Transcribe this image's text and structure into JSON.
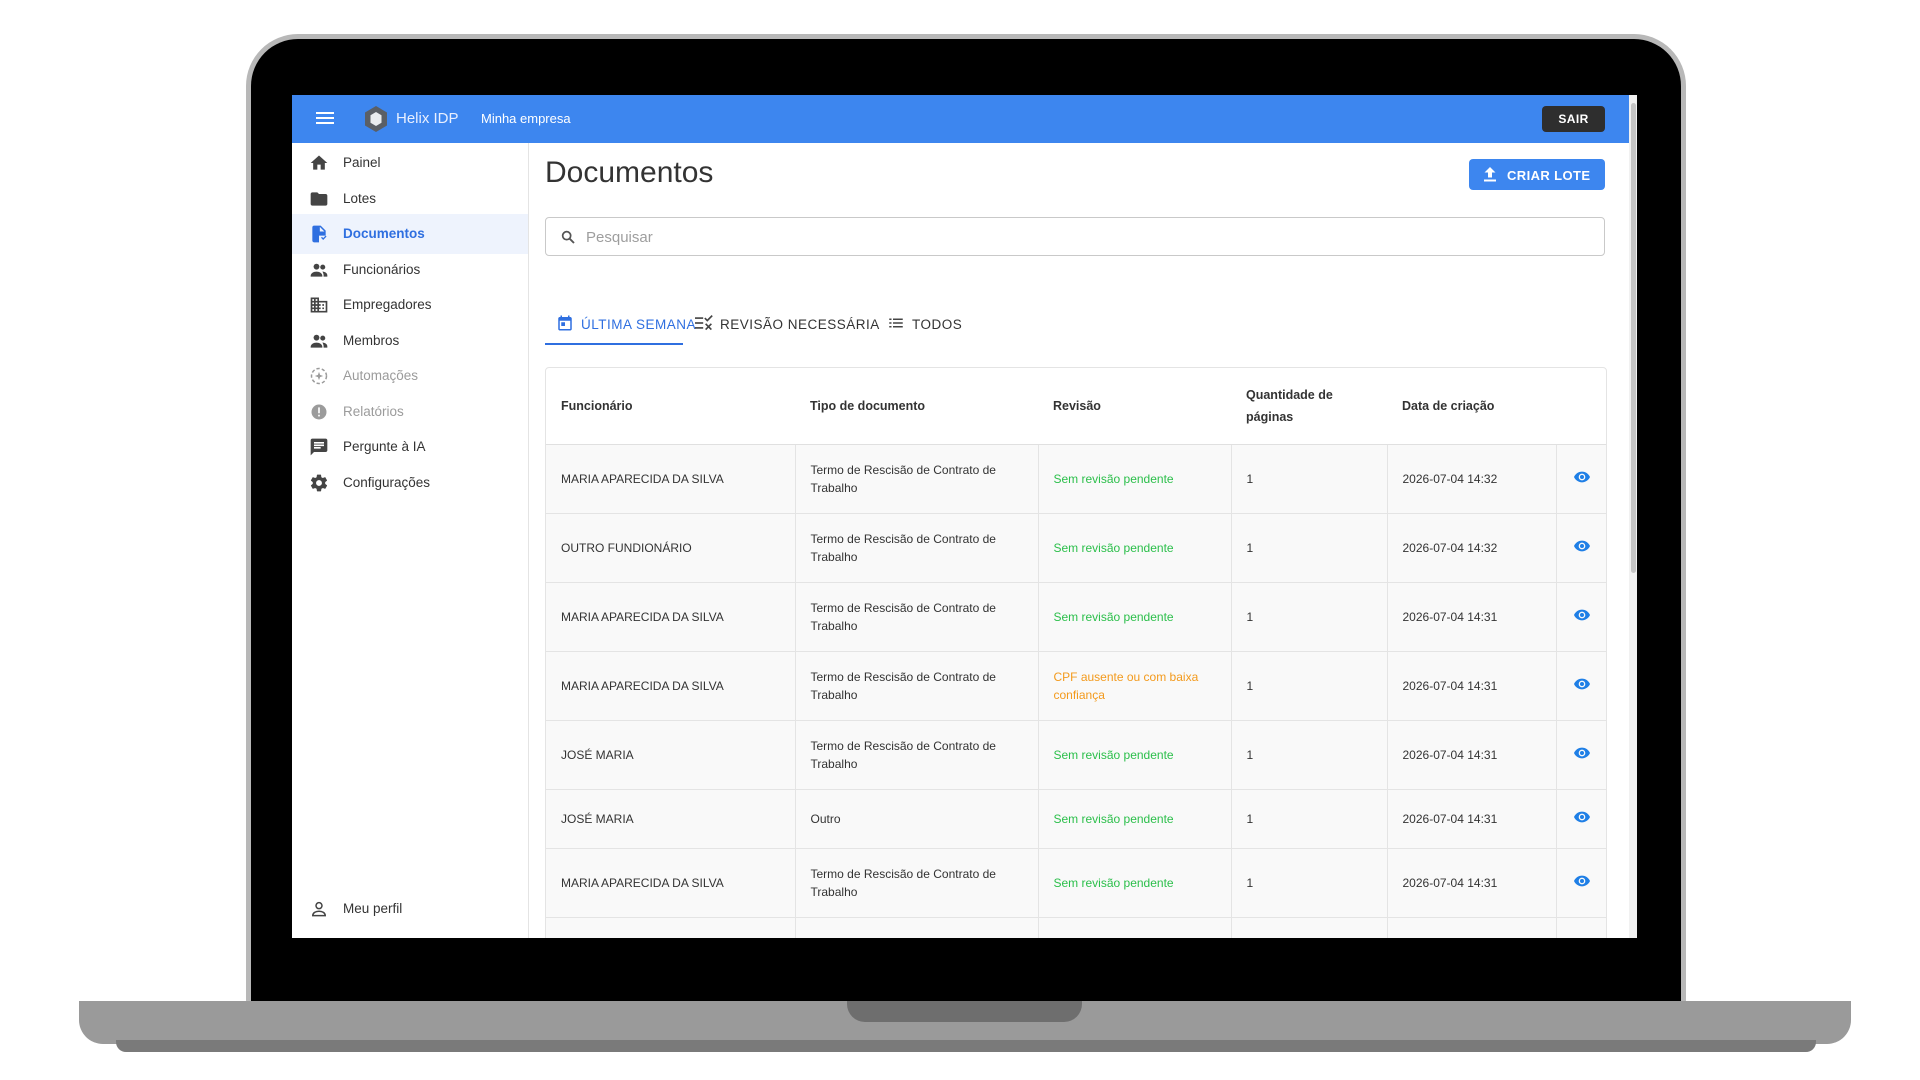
{
  "topbar": {
    "brand": "Helix IDP",
    "company": "Minha empresa",
    "logout_label": "SAIR"
  },
  "sidebar": {
    "items": [
      {
        "label": "Painel",
        "icon": "home-icon"
      },
      {
        "label": "Lotes",
        "icon": "folder-icon"
      },
      {
        "label": "Documentos",
        "icon": "document-icon",
        "active": true
      },
      {
        "label": "Funcionários",
        "icon": "people-icon"
      },
      {
        "label": "Empregadores",
        "icon": "building-icon"
      },
      {
        "label": "Membros",
        "icon": "people-icon"
      },
      {
        "label": "Automações",
        "icon": "automation-icon",
        "disabled": true
      },
      {
        "label": "Relatórios",
        "icon": "alert-icon",
        "disabled": true
      },
      {
        "label": "Pergunte à IA",
        "icon": "chat-icon"
      },
      {
        "label": "Configurações",
        "icon": "gear-icon"
      }
    ],
    "profile_label": "Meu perfil"
  },
  "main": {
    "title": "Documentos",
    "create_label": "CRIAR LOTE",
    "search_placeholder": "Pesquisar",
    "tabs": [
      {
        "label": "ÚLTIMA SEMANA",
        "icon": "calendar-icon",
        "active": true
      },
      {
        "label": "REVISÃO NECESSÁRIA",
        "icon": "review-list-icon"
      },
      {
        "label": "TODOS",
        "icon": "list-icon"
      }
    ],
    "table": {
      "headers": [
        "Funcionário",
        "Tipo de documento",
        "Revisão",
        "Quantidade de páginas",
        "Data de criação"
      ],
      "rows": [
        {
          "employee": "MARIA APARECIDA DA SILVA",
          "type": "Termo de Rescisão de Contrato de Trabalho",
          "review": "Sem revisão pendente",
          "review_status": "ok",
          "pages": "1",
          "created": "2026-07-04 14:32"
        },
        {
          "employee": "OUTRO FUNDIONÁRIO",
          "type": "Termo de Rescisão de Contrato de Trabalho",
          "review": "Sem revisão pendente",
          "review_status": "ok",
          "pages": "1",
          "created": "2026-07-04 14:32"
        },
        {
          "employee": "MARIA APARECIDA DA SILVA",
          "type": "Termo de Rescisão de Contrato de Trabalho",
          "review": "Sem revisão pendente",
          "review_status": "ok",
          "pages": "1",
          "created": "2026-07-04 14:31"
        },
        {
          "employee": "MARIA APARECIDA DA SILVA",
          "type": "Termo de Rescisão de Contrato de Trabalho",
          "review": "CPF ausente ou com baixa confiança",
          "review_status": "warn",
          "pages": "1",
          "created": "2026-07-04 14:31"
        },
        {
          "employee": "JOSÉ MARIA",
          "type": "Termo de Rescisão de Contrato de Trabalho",
          "review": "Sem revisão pendente",
          "review_status": "ok",
          "pages": "1",
          "created": "2026-07-04 14:31"
        },
        {
          "employee": "JOSÉ MARIA",
          "type": "Outro",
          "review": "Sem revisão pendente",
          "review_status": "ok",
          "pages": "1",
          "created": "2026-07-04 14:31"
        },
        {
          "employee": "MARIA APARECIDA DA SILVA",
          "type": "Termo de Rescisão de Contrato de Trabalho",
          "review": "Sem revisão pendente",
          "review_status": "ok",
          "pages": "1",
          "created": "2026-07-04 14:31"
        }
      ]
    }
  },
  "colors": {
    "primary": "#3d86ef",
    "ok": "#2bbf4a",
    "warn": "#f39a1c",
    "active_bg": "#eef3fd"
  }
}
